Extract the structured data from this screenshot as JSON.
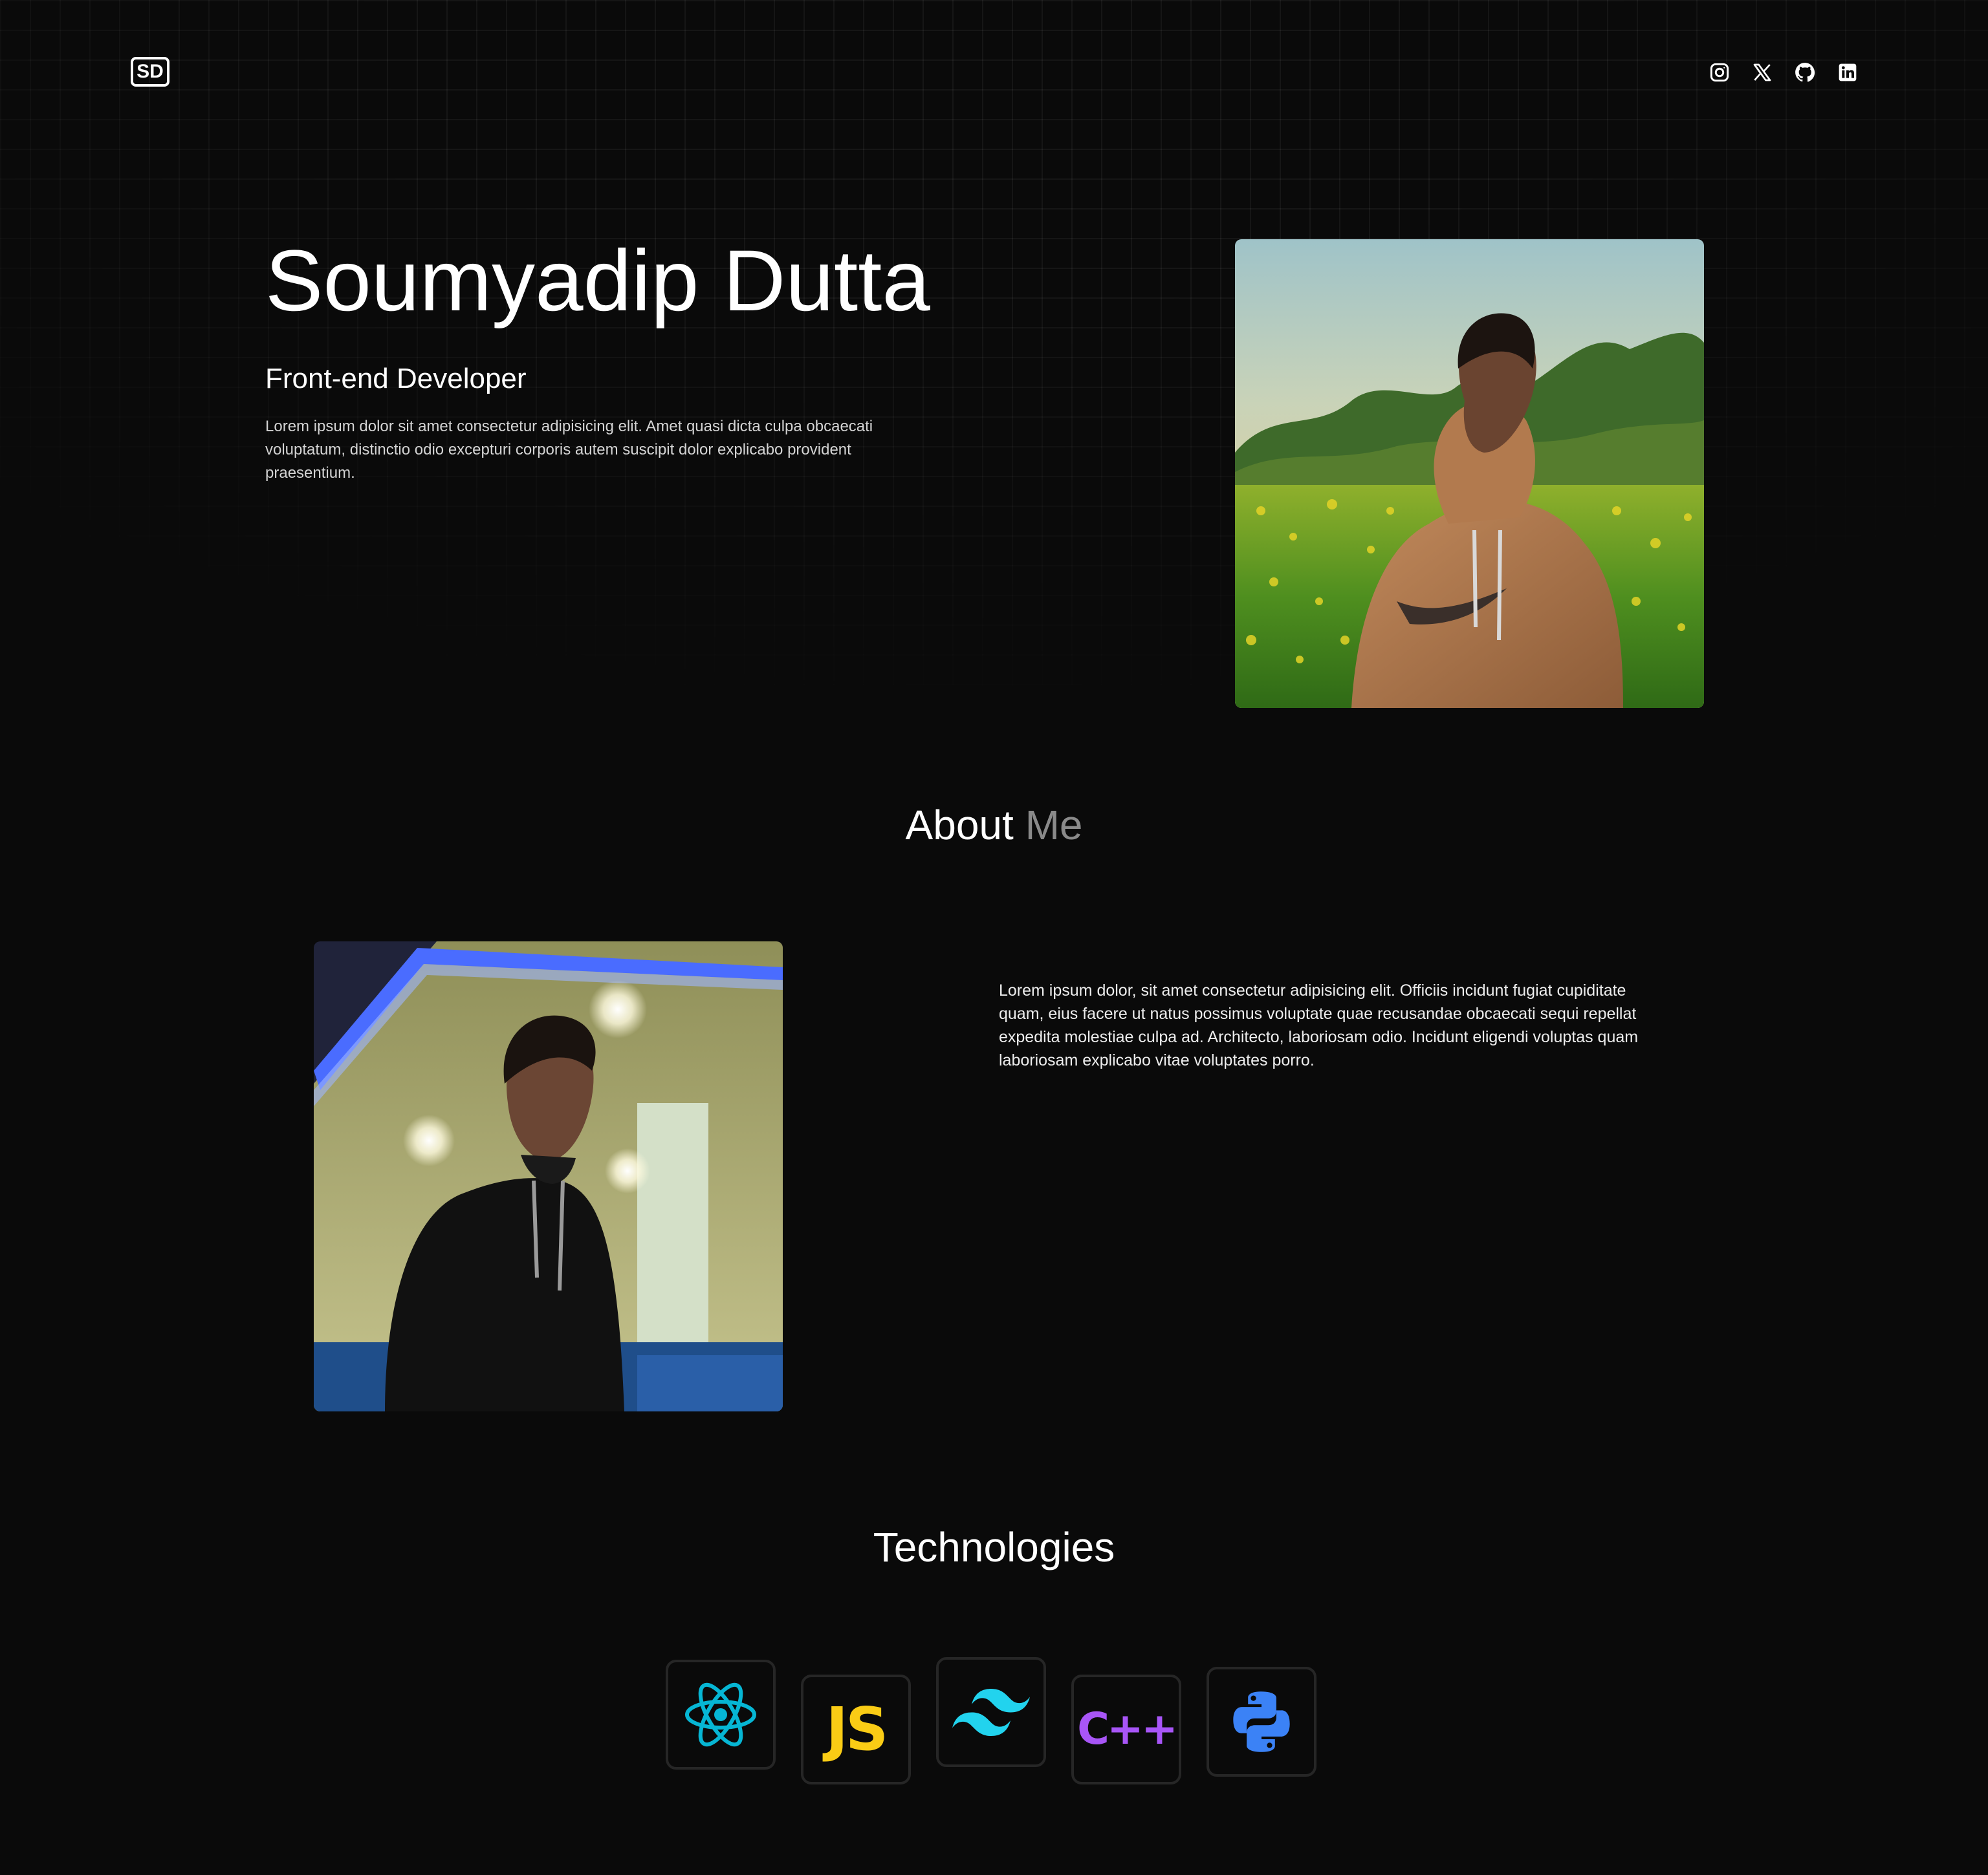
{
  "header": {
    "logo_text": "SD",
    "socials": [
      {
        "icon": "instagram-icon"
      },
      {
        "icon": "x-twitter-icon"
      },
      {
        "icon": "github-icon"
      },
      {
        "icon": "linkedin-icon"
      }
    ]
  },
  "hero": {
    "name": "Soumyadip Dutta",
    "role": "Front-end Developer",
    "description": "Lorem ipsum dolor sit amet consectetur adipisicing elit. Amet quasi dicta culpa obcaecati voluptatum, distinctio odio excepturi corporis autem suscipit dolor explicabo provident praesentium."
  },
  "about": {
    "title_main": "About",
    "title_accent": "Me",
    "text": "Lorem ipsum dolor, sit amet consectetur adipisicing elit. Officiis incidunt fugiat cupiditate quam, eius facere ut natus possimus voluptate quae recusandae obcaecati sequi repellat expedita molestiae culpa ad. Architecto, laboriosam odio. Incidunt eligendi voluptas quam laboriosam explicabo vitae voluptates porro."
  },
  "technologies": {
    "title": "Technologies",
    "items": [
      {
        "icon": "react-icon",
        "color": "#06b6d4"
      },
      {
        "icon": "javascript-icon",
        "label": "JS",
        "color": "#facc15"
      },
      {
        "icon": "tailwind-icon",
        "color": "#22d3ee"
      },
      {
        "icon": "cplusplus-icon",
        "label": "C++",
        "color": "#a855f7"
      },
      {
        "icon": "python-icon",
        "color": "#3b82f6"
      }
    ]
  },
  "colors": {
    "background": "#0a0a0a",
    "text": "#ffffff",
    "muted": "#8a8a8a",
    "card_border": "#262626"
  }
}
